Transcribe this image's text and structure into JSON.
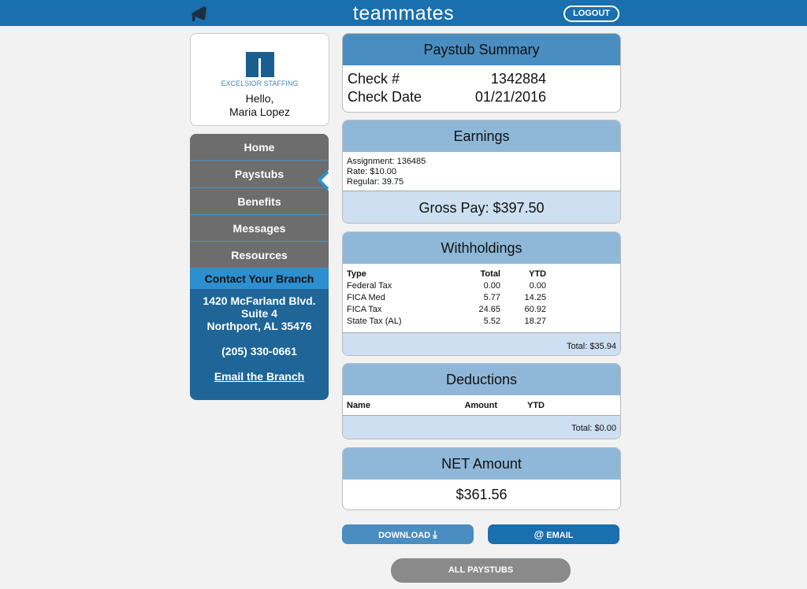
{
  "header": {
    "brand": "teammates",
    "logout": "LOGOUT"
  },
  "profile": {
    "company": "EXCELSIOR STAFFING",
    "greeting": "Hello,",
    "name": "Maria Lopez"
  },
  "nav": {
    "items": [
      {
        "label": "Home"
      },
      {
        "label": "Paystubs",
        "active": true
      },
      {
        "label": "Benefits"
      },
      {
        "label": "Messages"
      },
      {
        "label": "Resources"
      }
    ]
  },
  "branch": {
    "heading": "Contact Your Branch",
    "address1": "1420 McFarland Blvd.",
    "address2": "Suite 4",
    "address3": "Northport, AL 35476",
    "phone": "(205) 330-0661",
    "email_link": "Email the Branch"
  },
  "summary": {
    "title": "Paystub Summary",
    "check_label": "Check #",
    "check_value": "1342884",
    "date_label": "Check Date",
    "date_value": "01/21/2016"
  },
  "earnings": {
    "title": "Earnings",
    "assignment": "Assignment: 136485",
    "rate": "Rate: $10.00",
    "regular": "Regular: 39.75",
    "gross": "Gross Pay: $397.50"
  },
  "withholdings": {
    "title": "Withholdings",
    "columns": [
      "Type",
      "Total",
      "YTD"
    ],
    "rows": [
      [
        "Federal Tax",
        "0.00",
        "0.00"
      ],
      [
        "FICA Med",
        "5.77",
        "14.25"
      ],
      [
        "FICA Tax",
        "24.65",
        "60.92"
      ],
      [
        "State Tax (AL)",
        "5.52",
        "18.27"
      ]
    ],
    "total": "Total: $35.94"
  },
  "deductions": {
    "title": "Deductions",
    "columns": [
      "Name",
      "Amount",
      "YTD"
    ],
    "total": "Total: $0.00"
  },
  "net": {
    "title": "NET Amount",
    "value": "$361.56"
  },
  "actions": {
    "download": "DOWNLOAD",
    "email": "EMAIL",
    "all": "ALL PAYSTUBS"
  }
}
